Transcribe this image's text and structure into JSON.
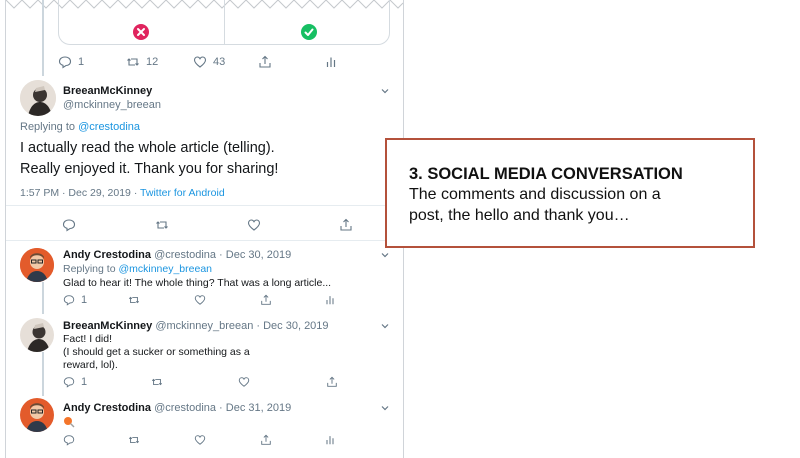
{
  "top_tweet": {
    "reply_count": "1",
    "retweet_count": "12",
    "like_count": "43"
  },
  "main_tweet": {
    "name": "BreeanMcKinney",
    "handle": "@mckinney_breean",
    "replying_label": "Replying to",
    "replying_to": "@crestodina",
    "text_line1": "I actually read the whole article (telling).",
    "text_line2": "Really enjoyed it. Thank you for sharing!",
    "timestamp": "1:57 PM · Dec 29, 2019 ·",
    "source": "Twitter for Android"
  },
  "replies": [
    {
      "name": "Andy Crestodina",
      "meta": "@crestodina · Dec 30, 2019",
      "replying_label": "Replying to",
      "replying_to": "@mckinney_breean",
      "text": "Glad to hear it! The whole thing? That was a long article...",
      "reply_count": "1"
    },
    {
      "name": "BreeanMcKinney",
      "meta": "@mckinney_breean · Dec 30, 2019",
      "text_line1": "Fact! I did!",
      "text_line2": "(I should get a sucker or something as a",
      "text_line3": "reward, lol).",
      "reply_count": "1"
    },
    {
      "name": "Andy Crestodina",
      "meta": "@crestodina · Dec 31, 2019"
    }
  ],
  "callout": {
    "heading": "3. SOCIAL MEDIA CONVERSATION",
    "body_line1": "The comments and discussion on a",
    "body_line2": "post, the hello and thank you…"
  },
  "colors": {
    "accent_blue": "#1b95e0",
    "callout_border": "#b4513b",
    "red_x": "#e0245e",
    "green_check": "#17bf63"
  }
}
